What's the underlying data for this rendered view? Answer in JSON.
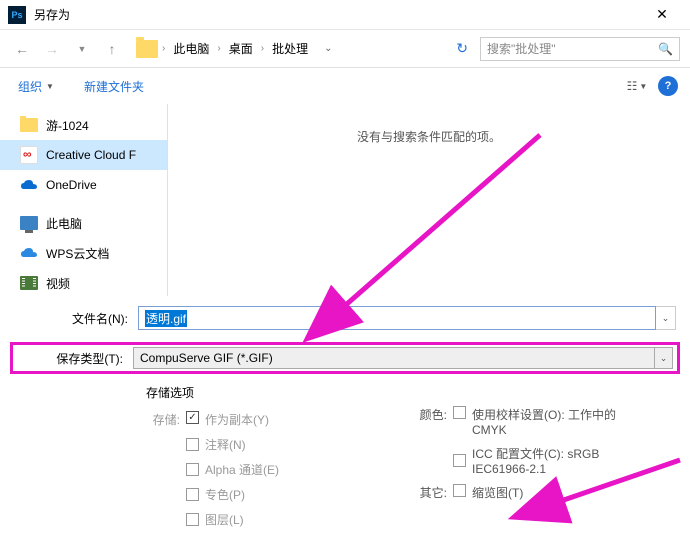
{
  "titlebar": {
    "title": "另存为"
  },
  "breadcrumb": {
    "items": [
      "此电脑",
      "桌面",
      "批处理"
    ]
  },
  "search": {
    "placeholder": "搜索\"批处理\""
  },
  "toolbar": {
    "organize": "组织",
    "newfolder": "新建文件夹"
  },
  "sidebar": {
    "items": [
      {
        "label": "游-1024"
      },
      {
        "label": "Creative Cloud F"
      },
      {
        "label": "OneDrive"
      },
      {
        "label": "此电脑"
      },
      {
        "label": "WPS云文档"
      },
      {
        "label": "视频"
      }
    ]
  },
  "content": {
    "empty": "没有与搜索条件匹配的项。"
  },
  "fields": {
    "filename_label": "文件名(N):",
    "filename_value": "透明.gif",
    "type_label": "保存类型(T):",
    "type_value": "CompuServe GIF (*.GIF)"
  },
  "options": {
    "title": "存储选项",
    "save_label": "存储:",
    "copy": "作为副本(Y)",
    "notes": "注释(N)",
    "alpha": "Alpha 通道(E)",
    "spot": "专色(P)",
    "layers": "图层(L)",
    "color_label": "颜色:",
    "proof": "使用校样设置(O): 工作中的 CMYK",
    "icc": "ICC 配置文件(C): sRGB IEC61966-2.1",
    "other_label": "其它:",
    "thumb": "缩览图(T)"
  }
}
